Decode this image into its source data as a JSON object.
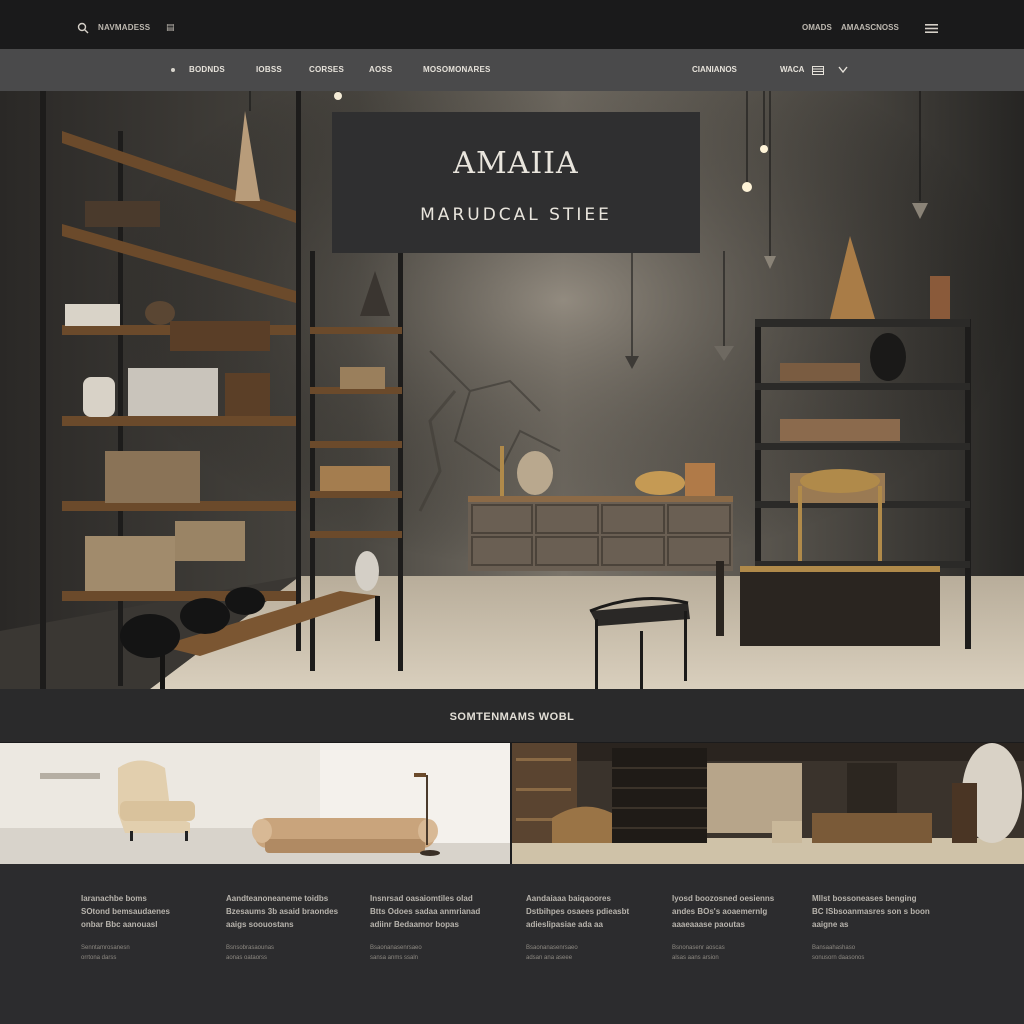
{
  "topbar": {
    "search_label": "NAVMADESS",
    "right_link_1": "OMADS",
    "right_link_2": "AMAASCNOSS"
  },
  "nav": {
    "items": [
      {
        "label": "BODNDS"
      },
      {
        "label": "IOBSS"
      },
      {
        "label": "CORSES"
      },
      {
        "label": "AOSS"
      },
      {
        "label": "MOSOMONARES"
      }
    ],
    "right_label": "CIANIANOS",
    "account_label": "WACA"
  },
  "hero": {
    "title": "AMAIIA",
    "subtitle": "MARUDCAL STIEE"
  },
  "section": {
    "title": "SOMTENMAMS WOBL"
  },
  "footer": {
    "columns": [
      {
        "lines": [
          "Iaranachbe boms",
          "SOtond bemsaudaenes",
          "onbar Bbc aanouasl"
        ],
        "meta": [
          "Senntamrosanesn",
          "orrtona darss"
        ]
      },
      {
        "lines": [
          "Aandteanoneaneme toidbs",
          "Bzesaums 3b asaid braondes",
          "aaigs soouostans"
        ],
        "meta": [
          "Bsnsobrasaounas",
          "aonas oataorss"
        ]
      },
      {
        "lines": [
          "Insnrsad oasaiomtiles olad",
          "Btts Odoes sadaa anmrianad",
          "adiinr Bedaamor bopas"
        ],
        "meta": [
          "Bsaonanasenrsaeo",
          "sansa anms ssaln"
        ]
      },
      {
        "lines": [
          "Aandaiaaa baiqaoores",
          "Dstbihpes osaees pdieasbt",
          "adieslipasiae ada aa"
        ],
        "meta": [
          "Bsaonanasenrsaeo",
          "adsan ana aseee"
        ]
      },
      {
        "lines": [
          "Iyosd boozosned oesienns",
          "andes BOs's aoaemernlg",
          "aaaeaaase paoutas"
        ],
        "meta": [
          "Bsnonasenr aoscas",
          "alsas aans arsion"
        ]
      },
      {
        "lines": [
          "Mllst bossoneases benging",
          "BC ISbsoanmasres son s boon",
          "aaigne as"
        ],
        "meta": [
          "Bansaahashaso",
          "sonusorn daasonos"
        ]
      }
    ]
  },
  "colors": {
    "topbar_bg": "#1a1a1b",
    "navbar_bg": "#4a4a4b",
    "hero_title_box": "#2f2f30",
    "footer_bg": "#2c2c2e",
    "accent_wood": "#6e4c2c",
    "accent_brass": "#b08a4a"
  }
}
